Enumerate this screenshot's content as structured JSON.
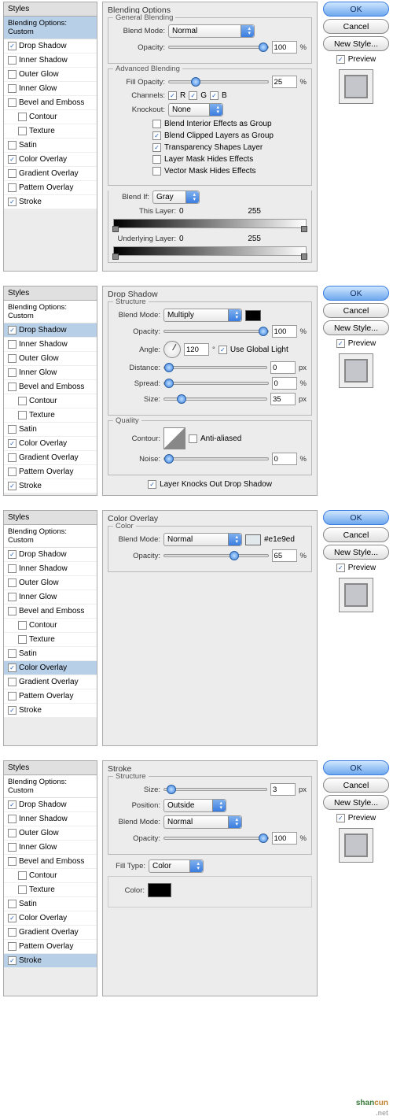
{
  "styles": {
    "header": "Styles",
    "sub": "Blending Options: Custom",
    "items": [
      {
        "label": "Drop Shadow",
        "on": true
      },
      {
        "label": "Inner Shadow",
        "on": false
      },
      {
        "label": "Outer Glow",
        "on": false
      },
      {
        "label": "Inner Glow",
        "on": false
      },
      {
        "label": "Bevel and Emboss",
        "on": false
      },
      {
        "label": "Contour",
        "on": false,
        "indent": true
      },
      {
        "label": "Texture",
        "on": false,
        "indent": true
      },
      {
        "label": "Satin",
        "on": false
      },
      {
        "label": "Color Overlay",
        "on": true
      },
      {
        "label": "Gradient Overlay",
        "on": false
      },
      {
        "label": "Pattern Overlay",
        "on": false
      },
      {
        "label": "Stroke",
        "on": true
      }
    ]
  },
  "buttons": {
    "ok": "OK",
    "cancel": "Cancel",
    "newstyle": "New Style...",
    "preview": "Preview"
  },
  "panel1": {
    "title": "Blending Options",
    "gen": {
      "legend": "General Blending",
      "blendmode_lbl": "Blend Mode:",
      "blendmode": "Normal",
      "opacity_lbl": "Opacity:",
      "opacity": "100",
      "pct": "%"
    },
    "adv": {
      "legend": "Advanced Blending",
      "fillop_lbl": "Fill Opacity:",
      "fillop": "25",
      "channels_lbl": "Channels:",
      "r": "R",
      "g": "G",
      "b": "B",
      "knock_lbl": "Knockout:",
      "knock": "None",
      "opts": [
        "Blend Interior Effects as Group",
        "Blend Clipped Layers as Group",
        "Transparency Shapes Layer",
        "Layer Mask Hides Effects",
        "Vector Mask Hides Effects"
      ],
      "opts_on": [
        false,
        true,
        true,
        false,
        false
      ]
    },
    "blendif": {
      "lbl": "Blend If:",
      "val": "Gray",
      "this_lbl": "This Layer:",
      "this_lo": "0",
      "this_hi": "255",
      "under_lbl": "Underlying Layer:",
      "under_lo": "0",
      "under_hi": "255"
    }
  },
  "panel2": {
    "title": "Drop Shadow",
    "struct": {
      "legend": "Structure",
      "blendmode_lbl": "Blend Mode:",
      "blendmode": "Multiply",
      "opacity_lbl": "Opacity:",
      "opacity": "100",
      "pct": "%",
      "angle_lbl": "Angle:",
      "angle": "120",
      "deg": "°",
      "useglobal": "Use Global Light",
      "dist_lbl": "Distance:",
      "dist": "0",
      "spread_lbl": "Spread:",
      "spread": "0",
      "size_lbl": "Size:",
      "size": "35",
      "px": "px"
    },
    "qual": {
      "legend": "Quality",
      "contour_lbl": "Contour:",
      "aa": "Anti-aliased",
      "noise_lbl": "Noise:",
      "noise": "0",
      "pct": "%"
    },
    "knocks": "Layer Knocks Out Drop Shadow"
  },
  "panel3": {
    "title": "Color Overlay",
    "color": {
      "legend": "Color",
      "blendmode_lbl": "Blend Mode:",
      "blendmode": "Normal",
      "hex": "#e1e9ed",
      "opacity_lbl": "Opacity:",
      "opacity": "65",
      "pct": "%"
    }
  },
  "panel4": {
    "title": "Stroke",
    "struct": {
      "legend": "Structure",
      "size_lbl": "Size:",
      "size": "3",
      "px": "px",
      "pos_lbl": "Position:",
      "pos": "Outside",
      "blendmode_lbl": "Blend Mode:",
      "blendmode": "Normal",
      "opacity_lbl": "Opacity:",
      "opacity": "100",
      "pct": "%"
    },
    "fill": {
      "type_lbl": "Fill Type:",
      "type": "Color",
      "color_lbl": "Color:",
      "color": "#000000"
    }
  },
  "logo": {
    "shan": "shan",
    "cun": "cun",
    "net": ".net"
  }
}
